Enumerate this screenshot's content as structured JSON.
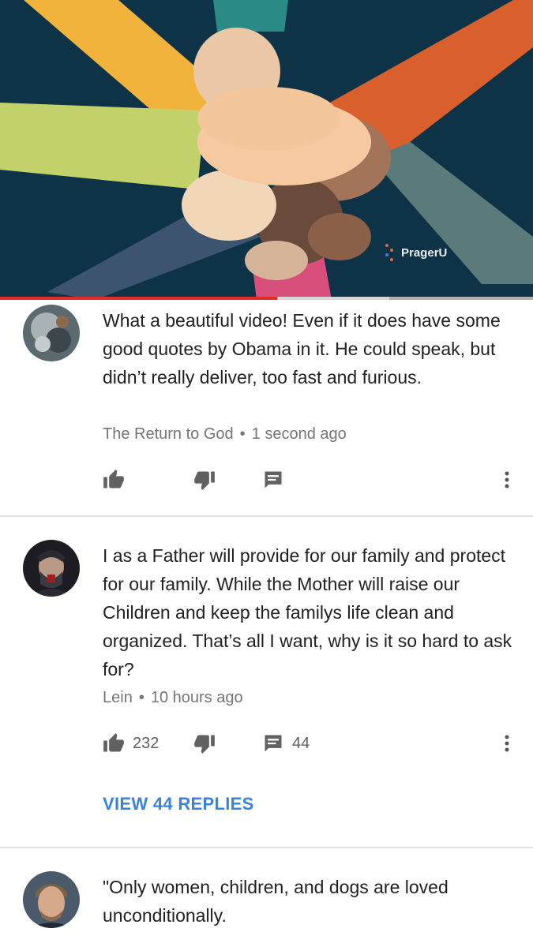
{
  "video": {
    "watermark": "PragerU",
    "progress_played_fraction": 0.52,
    "progress_buffered_fraction": 0.73,
    "colors": {
      "background": "#0e3347",
      "played": "#e52d27",
      "yellow_arm": "#f2b33d",
      "lime_arm": "#c3d16a",
      "orange_arm": "#d9602c",
      "teal_arm": "#5b7a7a",
      "pink_sleeve": "#d94f7c"
    }
  },
  "comments": [
    {
      "text": "What a beautiful video! Even if it does have some good quotes by Obama in it. He could speak, but didn’t really deliver, too fast and furious.",
      "author": "The Return to God",
      "time": "1 second ago",
      "likes": "",
      "replies": "",
      "avatar_icon": "avatar-abstract-icon"
    },
    {
      "text": "I as a Father will provide for our family and protect for our family. While the Mother will raise our Children and keep the familys life clean and organized. That’s all I want, why is it so hard to ask for?",
      "author": "Lein",
      "time": "10 hours ago",
      "likes": "232",
      "replies": "44",
      "view_replies_label": "VIEW 44 REPLIES",
      "avatar_icon": "avatar-portrait-icon"
    },
    {
      "text": "\"Only women, children, and dogs are loved unconditionally.",
      "avatar_icon": "avatar-portrait-icon"
    }
  ],
  "meta_separator": "•",
  "accent_color": "#3a82e0"
}
